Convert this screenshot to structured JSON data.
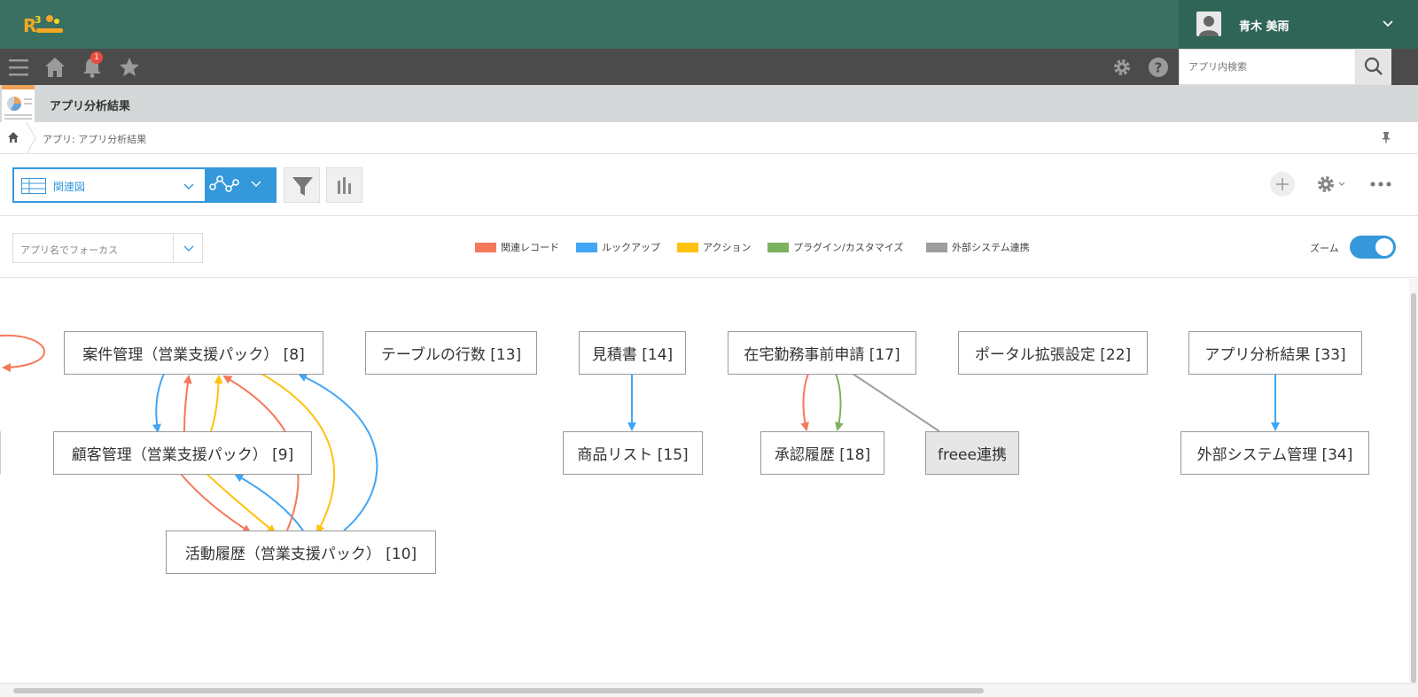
{
  "header": {
    "user_name": "青木 美雨"
  },
  "toolbar": {
    "notification_count": "1",
    "search_placeholder": "アプリ内検索"
  },
  "app": {
    "title": "アプリ分析結果"
  },
  "breadcrumb": {
    "text": "アプリ: アプリ分析結果"
  },
  "view": {
    "selected_view": "関連図"
  },
  "filter": {
    "focus_placeholder": "アプリ名でフォーカス",
    "zoom_label": "ズーム",
    "zoom_on": true
  },
  "legend": [
    {
      "label": "関連レコード",
      "color": "#f4795b"
    },
    {
      "label": "ルックアップ",
      "color": "#42a5f5"
    },
    {
      "label": "アクション",
      "color": "#ffc20e"
    },
    {
      "label": "プラグイン/カスタマイズ",
      "color": "#7cb25b"
    },
    {
      "label": "外部システム連携",
      "color": "#9e9e9e"
    }
  ],
  "nodes": {
    "n8": "案件管理（営業支援パック） [8]",
    "n9": "顧客管理（営業支援パック） [9]",
    "n10": "活動履歴（営業支援パック） [10]",
    "n13": "テーブルの行数 [13]",
    "n14": "見積書 [14]",
    "n15": "商品リスト [15]",
    "n17": "在宅勤務事前申請 [17]",
    "n18": "承認履歴 [18]",
    "freee": "freee連携",
    "n22": "ポータル拡張設定 [22]",
    "n33": "アプリ分析結果 [33]",
    "n34": "外部システム管理 [34]"
  }
}
